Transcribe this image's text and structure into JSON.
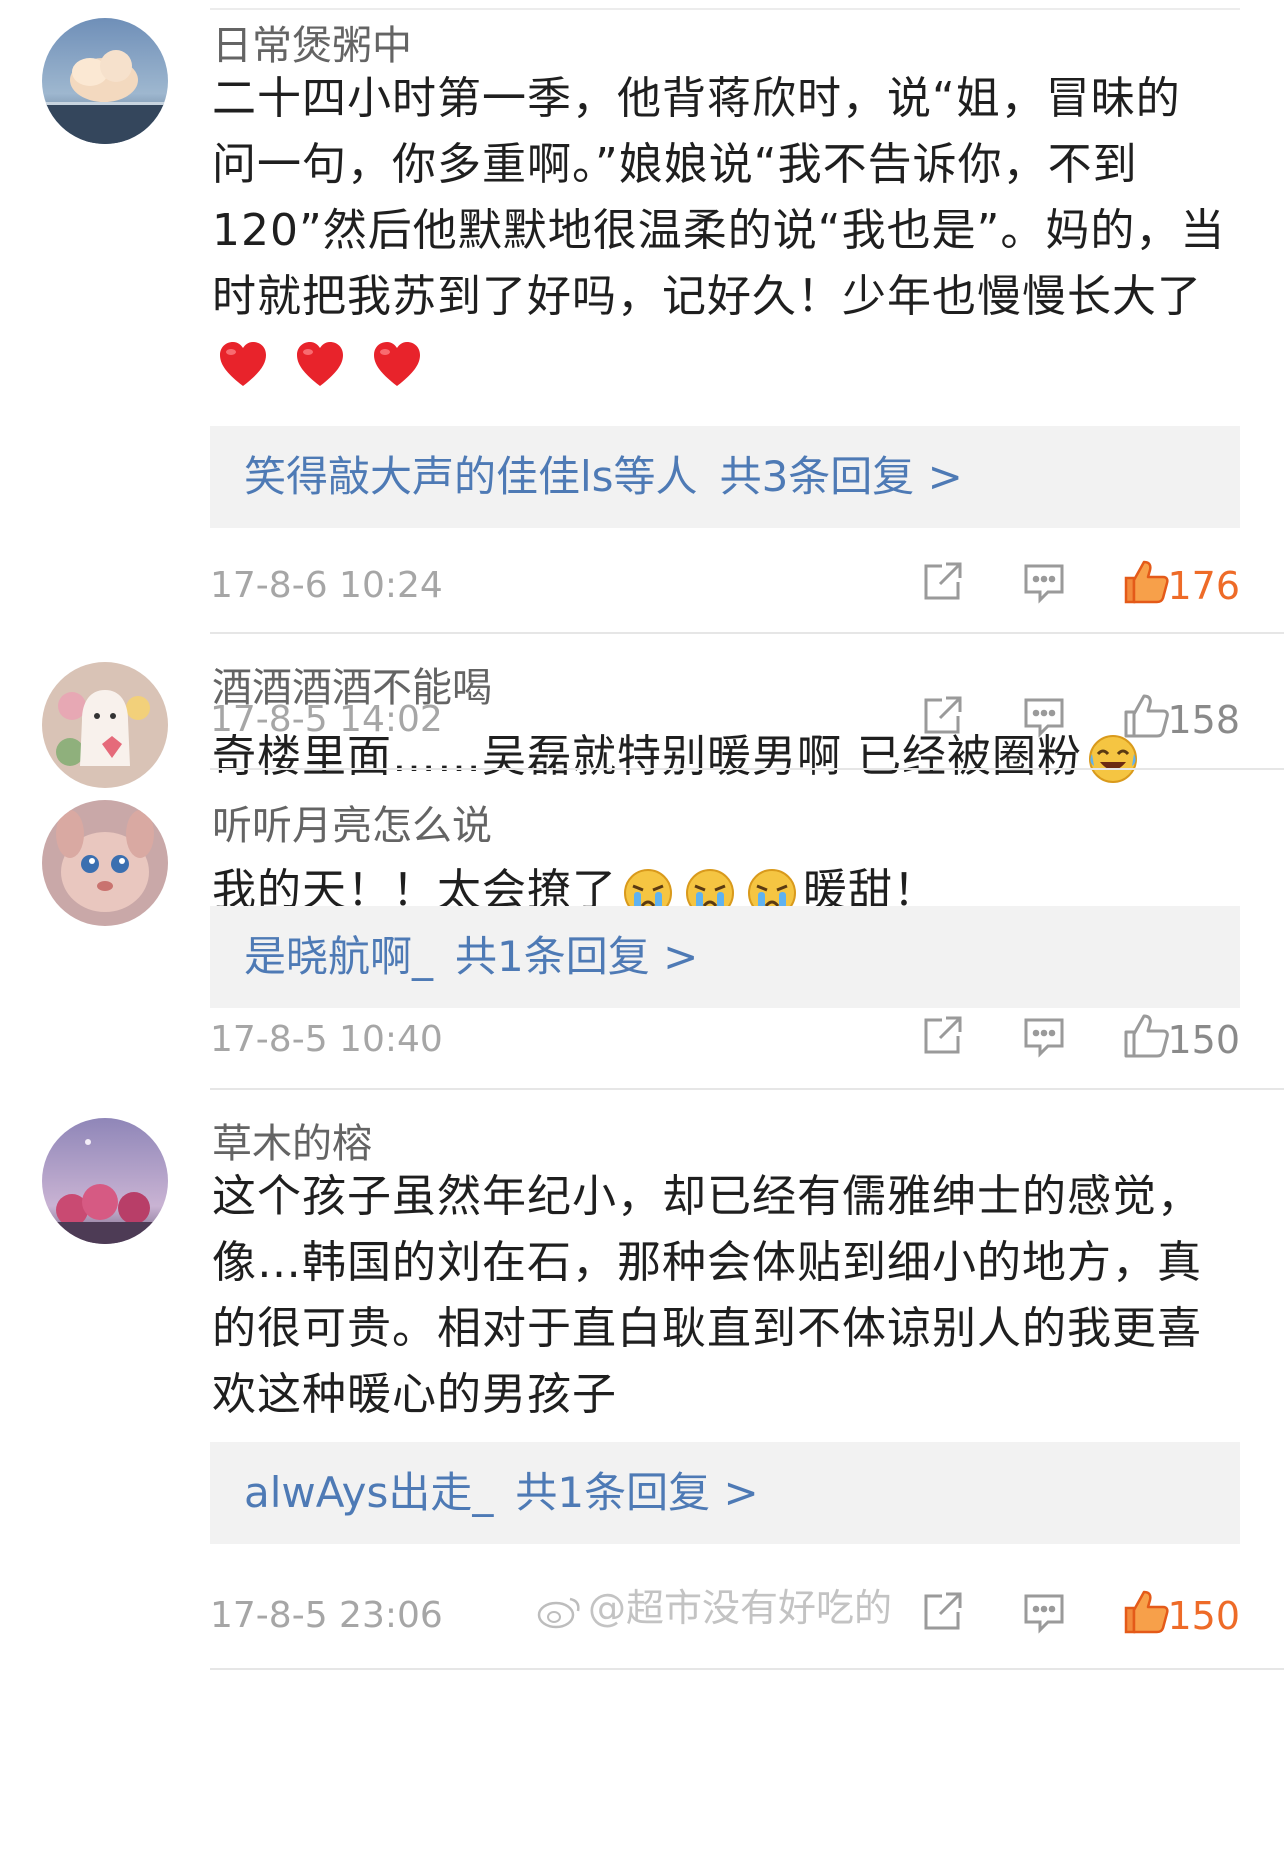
{
  "comments": [
    {
      "username": "日常煲粥中",
      "lines": [
        "二十四小时第一季，他背蒋欣时，说“姐，冒昧的",
        "问一句，你多重啊。”娘娘说“我不告诉你，不到",
        "120”然后他默默地很温柔的说“我也是”。妈的，当",
        "时就把我苏到了好吗，记好久！少年也慢慢长大了"
      ],
      "emoji_line": [
        "heart-emoji",
        "heart-emoji",
        "heart-emoji"
      ],
      "reply": {
        "names": "笑得敲大声的佳佳ls等人",
        "count": "共3条回复 >"
      },
      "time": "17-8-6 10:24",
      "likes": "176",
      "liked": true
    },
    {
      "username": "酒酒酒酒不能喝",
      "text_before": "奇楼里面……吴磊就特别暖男啊 已经被圈粉",
      "emoji_after": "laugh-cry-emoji",
      "time": "17-8-5 14:02",
      "likes": "158",
      "liked": false
    },
    {
      "username": "听听月亮怎么说",
      "text_before": "我的天！！太会撩了",
      "emojis": [
        "crying-emoji",
        "crying-emoji",
        "crying-emoji"
      ],
      "text_after": "暖甜！",
      "reply": {
        "names": "是晓航啊_",
        "count": "共1条回复 >"
      },
      "time": "17-8-5 10:40",
      "likes": "150",
      "liked": false
    },
    {
      "username": "草木的榕",
      "lines": [
        "这个孩子虽然年纪小，却已经有儒雅绅士的感觉，",
        "像…韩国的刘在石，那种会体贴到细小的地方，真",
        "的很可贵。相对于直白耿直到不体谅别人的我更喜",
        "欢这种暖心的男孩子"
      ],
      "reply": {
        "names": "alwAys出走_",
        "count": "共1条回复 >"
      },
      "time": "17-8-5 23:06",
      "likes": "150",
      "liked": true
    }
  ],
  "watermark": "@超市没有好吃的",
  "colors": {
    "link": "#4e7ab5",
    "liked": "#ee6b28",
    "muted": "#a6a6a6"
  }
}
